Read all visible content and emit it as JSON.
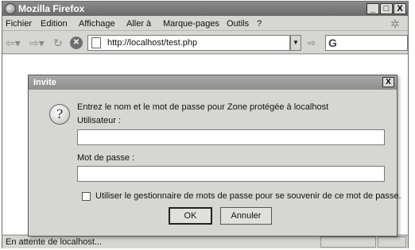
{
  "window": {
    "title": "Mozilla Firefox",
    "buttons": [
      "_",
      "□",
      "X"
    ]
  },
  "menubar": {
    "items": [
      "Fichier",
      "Edition",
      "Affichage",
      "Aller à",
      "Marque-pages",
      "Outils",
      "?"
    ]
  },
  "navbar": {
    "url": "http://localhost/test.php"
  },
  "statusbar": {
    "text": "En attente de localhost..."
  },
  "dialog": {
    "title": "Invite",
    "close_label": "X",
    "message": "Entrez le nom et le mot de passe pour Zone protégée à localhost",
    "username_label": "Utilisateur :",
    "username_value": "",
    "password_label": "Mot de passe :",
    "password_value": "",
    "remember_label": "Utiliser le gestionnaire de mots de passe pour se souvenir de ce mot de passe.",
    "remember_checked": false,
    "ok_label": "OK",
    "cancel_label": "Annuler"
  }
}
